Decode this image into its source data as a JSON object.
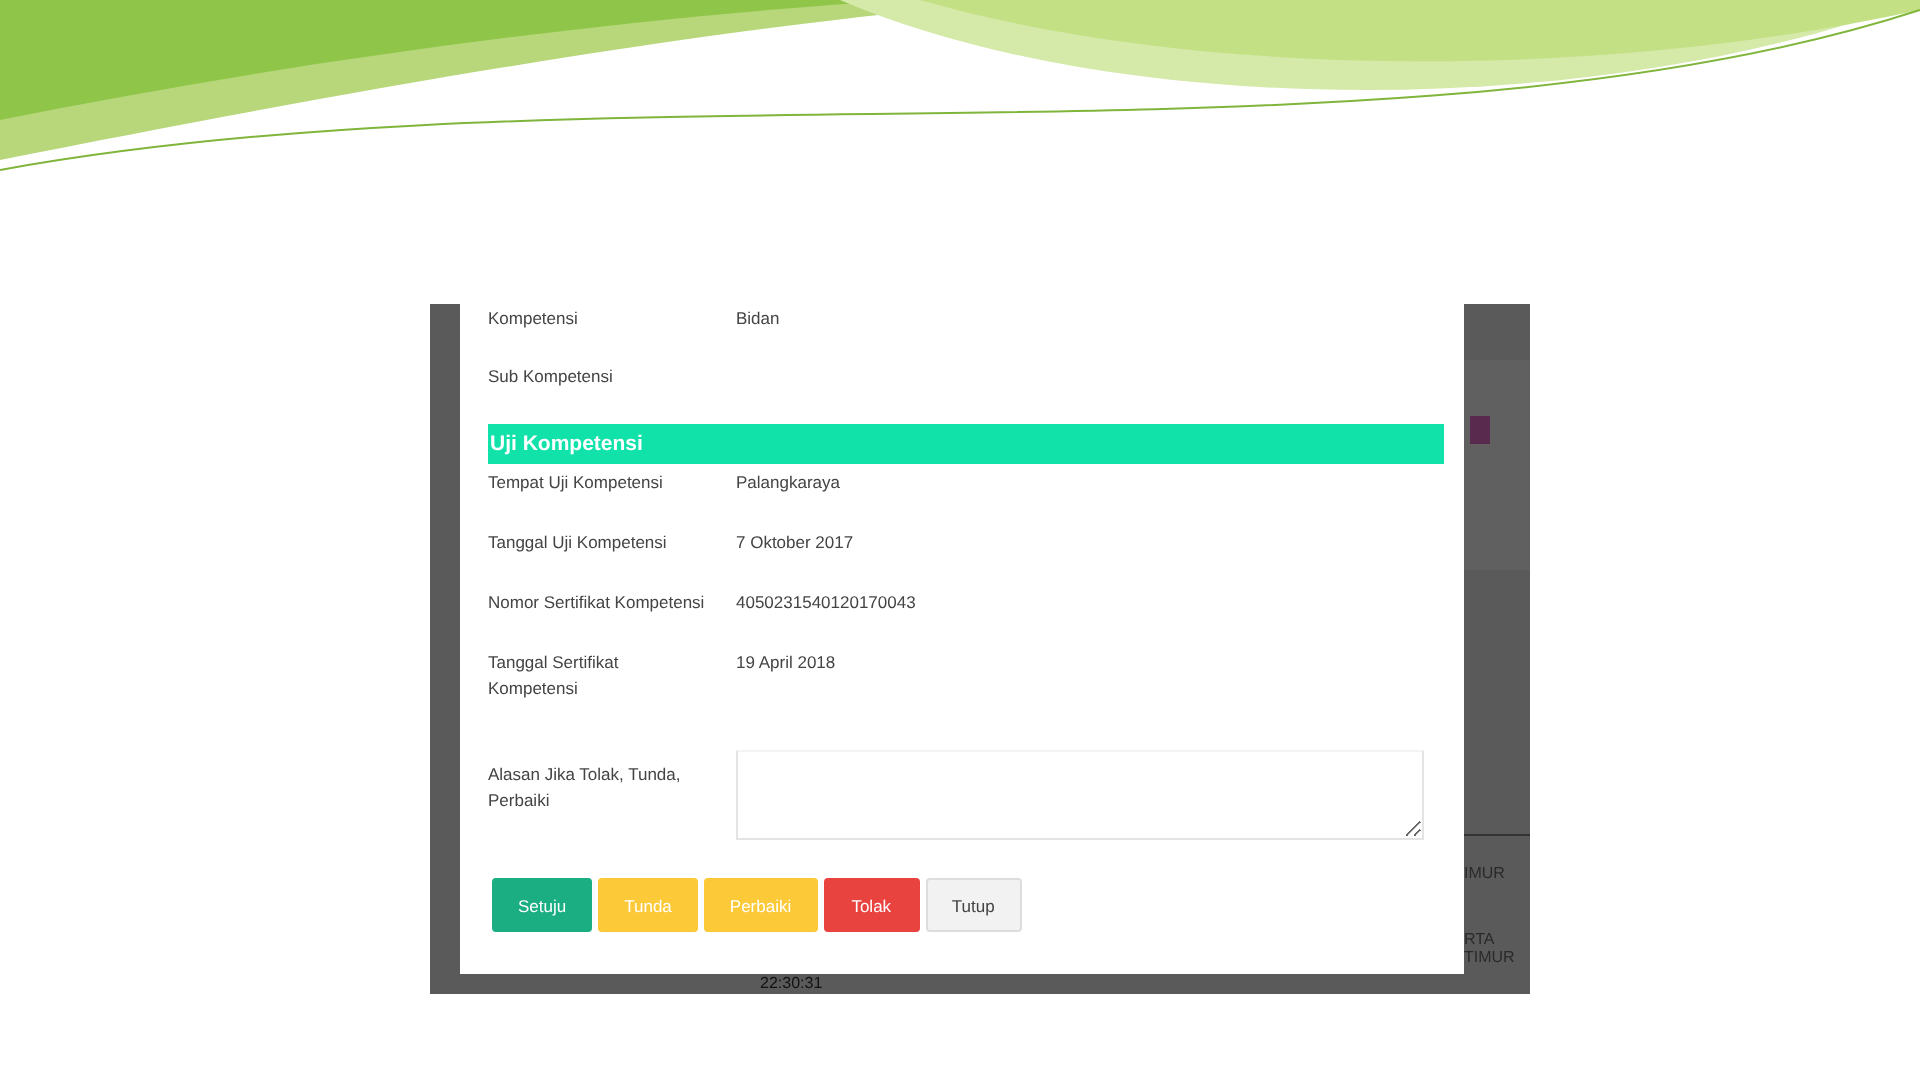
{
  "modal": {
    "top_fields": [
      {
        "label": "Kompetensi",
        "value": "Bidan"
      },
      {
        "label": "Sub Kompetensi"
      }
    ],
    "section": {
      "title": "Uji Kompetensi"
    },
    "fields": [
      {
        "label": "Tempat Uji Kompetensi",
        "value": "Palangkaraya"
      },
      {
        "label": "Tanggal Uji Kompetensi",
        "value": "7 Oktober 2017"
      },
      {
        "label": "Nomor Sertifikat Kompetensi",
        "value": "4050231540120170043"
      },
      {
        "label": "Tanggal Sertifikat Kompetensi",
        "value": "19 April 2018"
      }
    ],
    "reason": {
      "label": "Alasan Jika Tolak, Tunda, Perbaiki"
    },
    "buttons": [
      {
        "label": "Setuju",
        "kind": "success"
      },
      {
        "label": "Tunda",
        "kind": "warning"
      },
      {
        "label": "Perbaiki",
        "kind": "warning"
      },
      {
        "label": "Tolak",
        "kind": "danger"
      },
      {
        "label": "Tutup",
        "kind": "default"
      }
    ]
  },
  "background": {
    "right_texts": [
      "IMUR",
      "RTA",
      "TIMUR"
    ],
    "bottom_texts": [
      "22:30:31"
    ]
  }
}
